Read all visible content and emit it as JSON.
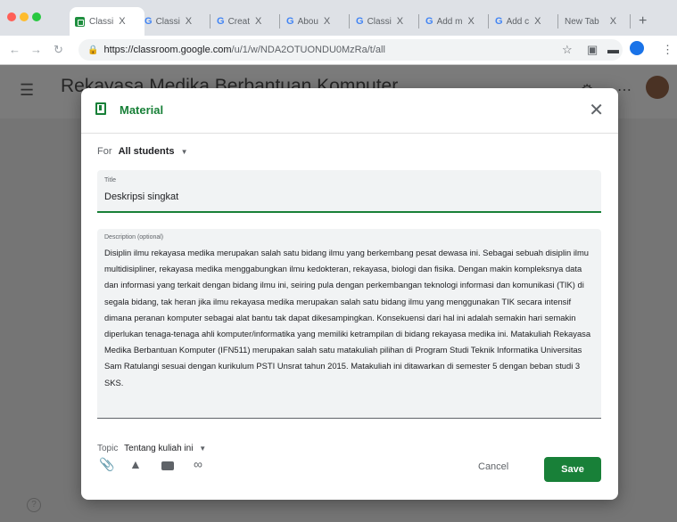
{
  "browser": {
    "tabs": [
      {
        "label": "Classi",
        "close": "X"
      },
      {
        "label": "Classi",
        "close": "X"
      },
      {
        "label": "Creat",
        "close": "X"
      },
      {
        "label": "Abou",
        "close": "X"
      },
      {
        "label": "Classi",
        "close": "X"
      },
      {
        "label": "Add m",
        "close": "X"
      },
      {
        "label": "Add c",
        "close": "X"
      },
      {
        "label": "New Tab",
        "close": "X"
      }
    ],
    "new_tab": "+",
    "url_host": "https://classroom.google.com",
    "url_path": "/u/1/w/NDA2OTUONDU0MzRa/t/all"
  },
  "app": {
    "course_title": "Rekayasa Medika Berbantuan Komputer",
    "help": "?"
  },
  "modal": {
    "title": "Material",
    "for_label": "For",
    "for_value": "All students",
    "title_field_label": "Title",
    "title_field_value": "Deskripsi singkat",
    "desc_field_label": "Description (optional)",
    "desc_field_value": "Disiplin ilmu rekayasa medika merupakan salah satu bidang ilmu yang berkembang pesat dewasa ini. Sebagai sebuah disiplin ilmu multidisipliner, rekayasa medika menggabungkan ilmu kedokteran, rekayasa, biologi dan fisika. Dengan makin kompleksnya data dan informasi yang terkait dengan bidang ilmu ini, seiring pula dengan perkembangan teknologi informasi dan komunikasi (TIK) di segala bidang, tak heran jika ilmu rekayasa medika merupakan salah satu bidang ilmu yang menggunakan TIK secara intensif dimana peranan komputer sebagai alat bantu tak dapat dikesampingkan. Konsekuensi dari hal ini adalah semakin hari semakin diperlukan tenaga-tenaga ahli komputer/informatika yang memiliki ketrampilan di bidang rekayasa medika ini. Matakuliah Rekayasa Medika Berbantuan Komputer (IFN511) merupakan salah satu matakuliah pilihan di Program Studi Teknik Informatika Universitas Sam Ratulangi sesuai dengan kurikulum PSTI Unsrat tahun 2015. Matakuliah ini ditawarkan di semester 5 dengan beban studi 3 SKS.",
    "topic_label": "Topic",
    "topic_value": "Tentang kuliah ini",
    "cancel_label": "Cancel",
    "save_label": "Save"
  },
  "colors": {
    "accent": "#188038",
    "overlay": "#757575",
    "tabstrip": "#dee1e6"
  },
  "icons": [
    "classroom-icon",
    "google-icon",
    "lock-icon",
    "star-icon",
    "apps-icon",
    "account-icon",
    "menu-icon",
    "settings-icon",
    "material-icon",
    "close-icon",
    "attach-icon",
    "drive-icon",
    "youtube-icon",
    "link-icon",
    "help-icon"
  ]
}
